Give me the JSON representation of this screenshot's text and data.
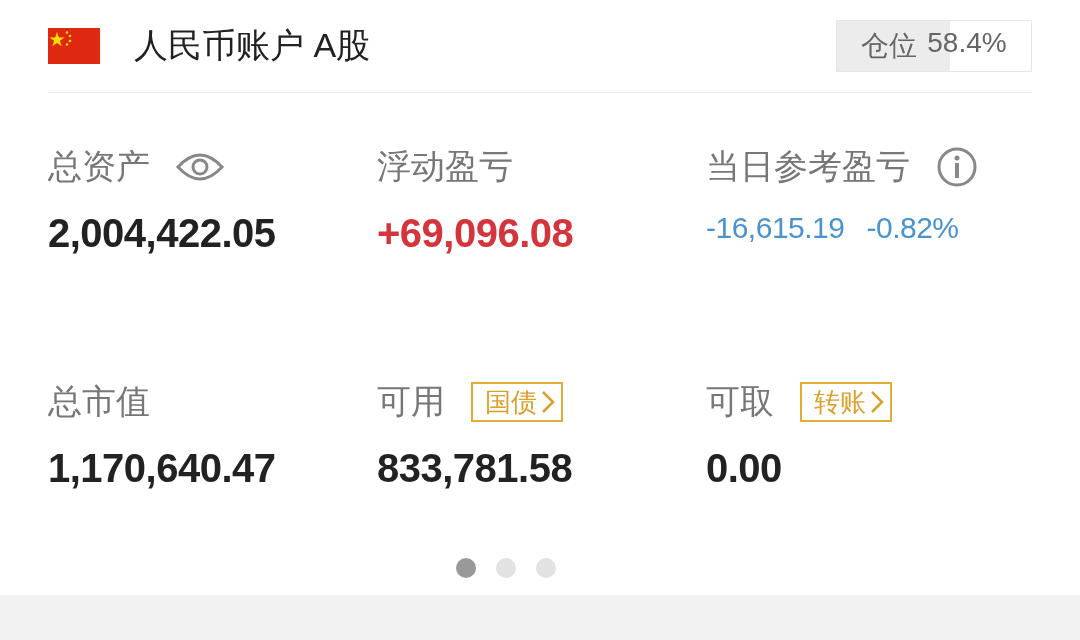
{
  "account": {
    "title": "人民币账户 A股",
    "position": {
      "label": "仓位",
      "value": "58.4%",
      "level": 0.584
    }
  },
  "metric_rows": [
    {
      "cells": [
        {
          "label": "总资产",
          "kind": "eye",
          "values": [
            {
              "text": "2,004,422.05",
              "kind": "plain"
            }
          ]
        },
        {
          "label": "浮动盈亏",
          "kind": "plain",
          "values": [
            {
              "text": "+69,096.08",
              "kind": "gain"
            }
          ]
        },
        {
          "label": "当日参考盈亏",
          "kind": "info",
          "values": [
            {
              "text": "-16,615.19",
              "kind": "loss"
            },
            {
              "text": "-0.82%",
              "kind": "loss"
            }
          ]
        }
      ]
    },
    {
      "cells": [
        {
          "label": "总市值",
          "kind": "plain",
          "values": [
            {
              "text": "1,170,640.47",
              "kind": "plain"
            }
          ]
        },
        {
          "label": "可用",
          "kind": "tag",
          "tag": "国债",
          "values": [
            {
              "text": "833,781.58",
              "kind": "plain"
            }
          ]
        },
        {
          "label": "可取",
          "kind": "tag",
          "tag": "转账",
          "values": [
            {
              "text": "0.00",
              "kind": "plain"
            }
          ]
        }
      ]
    }
  ],
  "pager": [
    {
      "selected": true
    },
    {
      "selected": false
    },
    {
      "selected": false
    }
  ]
}
